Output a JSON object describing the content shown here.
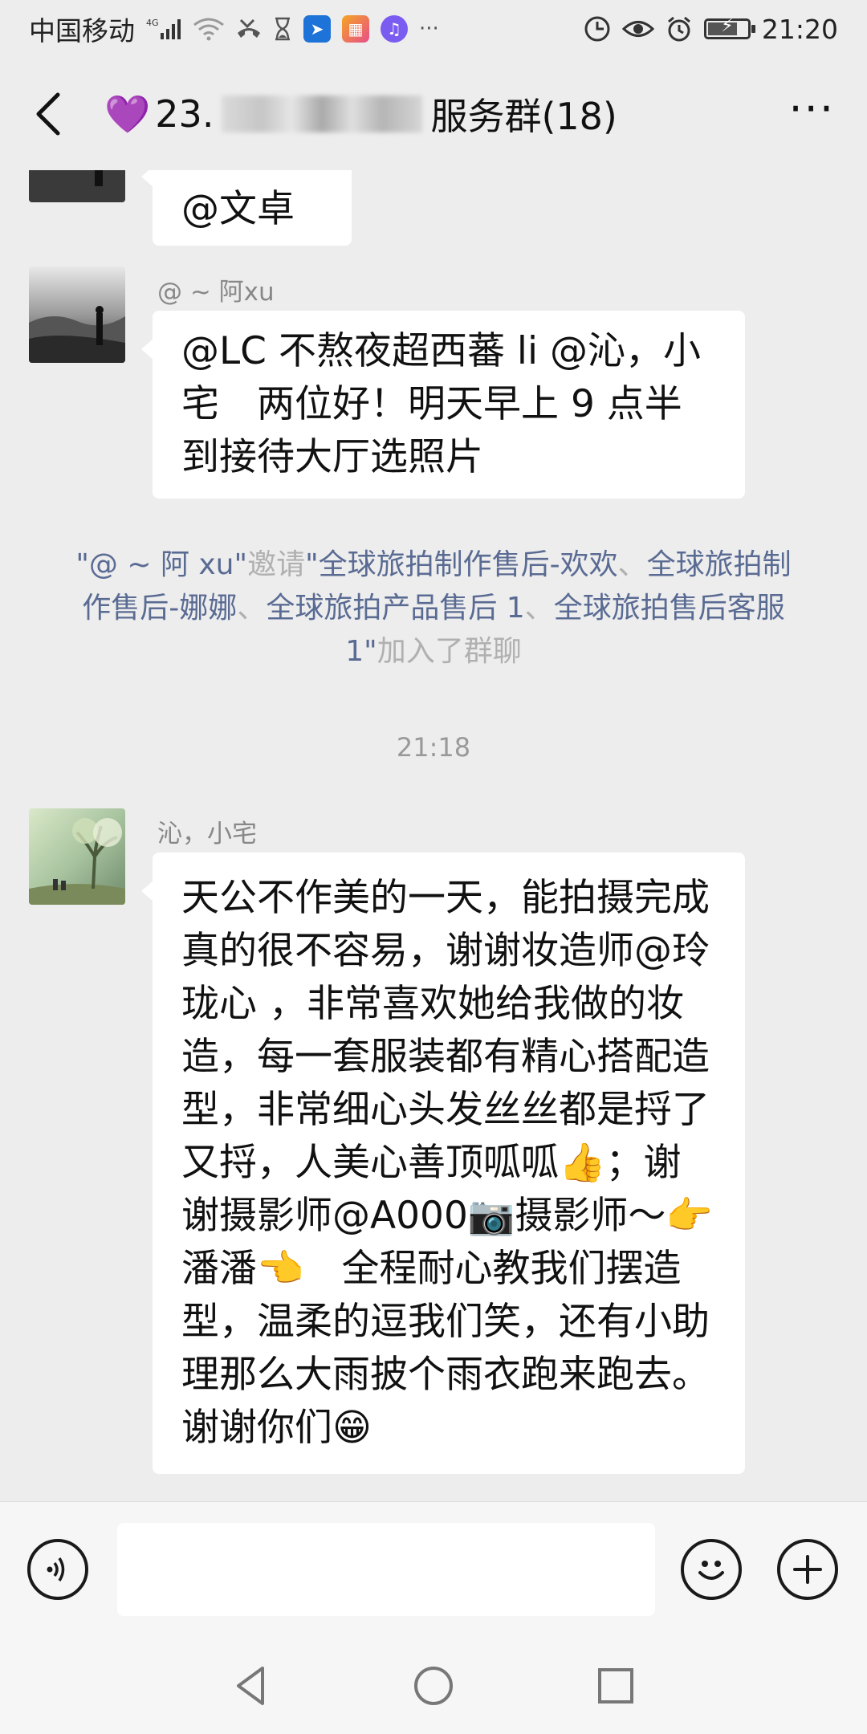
{
  "status_bar": {
    "carrier": "中国移动",
    "network": "4G",
    "time": "21:20"
  },
  "header": {
    "title_prefix": "23.",
    "title_suffix": "服务群(18)",
    "more_label": "···"
  },
  "messages": [
    {
      "text": "@文卓"
    },
    {
      "sender": "@ ~ 阿xu",
      "text": "@LC 不熬夜超西蕃 li @沁，小宅　两位好！明天早上 9 点半到接待大厅选照片"
    }
  ],
  "system_notice": {
    "inviter": "\"@ ~ 阿 xu\"",
    "invite_word": "邀请",
    "invitees": [
      "\"全球旅拍制作售后-欢欢",
      "全球旅拍制作售后-娜娜",
      "全球旅拍产品售后 1",
      "全球旅拍售后客服 1\""
    ],
    "separator": "、",
    "joined": "加入了群聊"
  },
  "timestamp": "21:18",
  "long_message": {
    "sender": "沁，小宅",
    "text": "天公不作美的一天，能拍摄完成真的很不容易，谢谢妆造师@玲珑心 ，非常喜欢她给我做的妆造，每一套服装都有精心搭配造型，非常细心头发丝丝都是捋了又捋，人美心善顶呱呱👍；谢谢摄影师@A000📷摄影师～👉潘潘👈　全程耐心教我们摆造型，温柔的逗我们笑，还有小助理那么大雨披个雨衣跑来跑去。谢谢你们😁"
  },
  "input": {
    "value": "",
    "placeholder": ""
  },
  "icons": {
    "back": "chevron-left-icon",
    "more": "more-icon",
    "voice": "voice-icon",
    "emoji": "emoji-icon",
    "plus": "plus-icon",
    "nav_back": "triangle-back-icon",
    "nav_home": "circle-home-icon",
    "nav_recent": "square-recent-icon"
  },
  "colors": {
    "background": "#ededed",
    "bubble": "#ffffff",
    "link": "#5a6b93",
    "heart": "#9b3be8"
  }
}
